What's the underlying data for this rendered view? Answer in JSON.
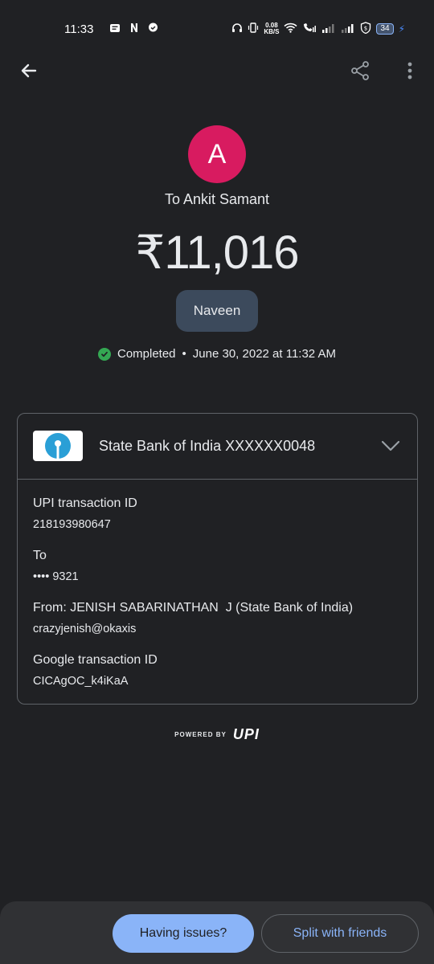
{
  "status_bar": {
    "time": "11:33",
    "notif_icons": [
      "message-icon",
      "netflix-icon",
      "chat-icon"
    ],
    "net_speed_value": "0.08",
    "net_speed_unit": "KB/S",
    "battery": "34"
  },
  "payment": {
    "avatar_letter": "A",
    "recipient": "To Ankit Samant",
    "amount": "₹11,016",
    "note": "Naveen",
    "status": "Completed",
    "separator": "•",
    "datetime": "June 30, 2022 at 11:32 AM"
  },
  "bank": {
    "name": "State Bank of India XXXXXX0048"
  },
  "details": [
    {
      "label": "UPI transaction ID",
      "value": "218193980647"
    },
    {
      "label": "To",
      "value": "•••• 9321"
    },
    {
      "label": "From: JENISH SABARINATHAN  J (State Bank of India)",
      "value": "crazyjenish@okaxis"
    },
    {
      "label": "Google transaction ID",
      "value": "CICAgOC_k4iKaA"
    }
  ],
  "footer": {
    "powered_by": "POWERED BY",
    "upi_logo": "UPI"
  },
  "actions": {
    "issues_label": "Having issues?",
    "split_label": "Split with friends"
  },
  "colors": {
    "background": "#202124",
    "avatar": "#d81b60",
    "chip": "#3c4a5c",
    "success": "#34a853",
    "accent": "#8ab4f8"
  }
}
